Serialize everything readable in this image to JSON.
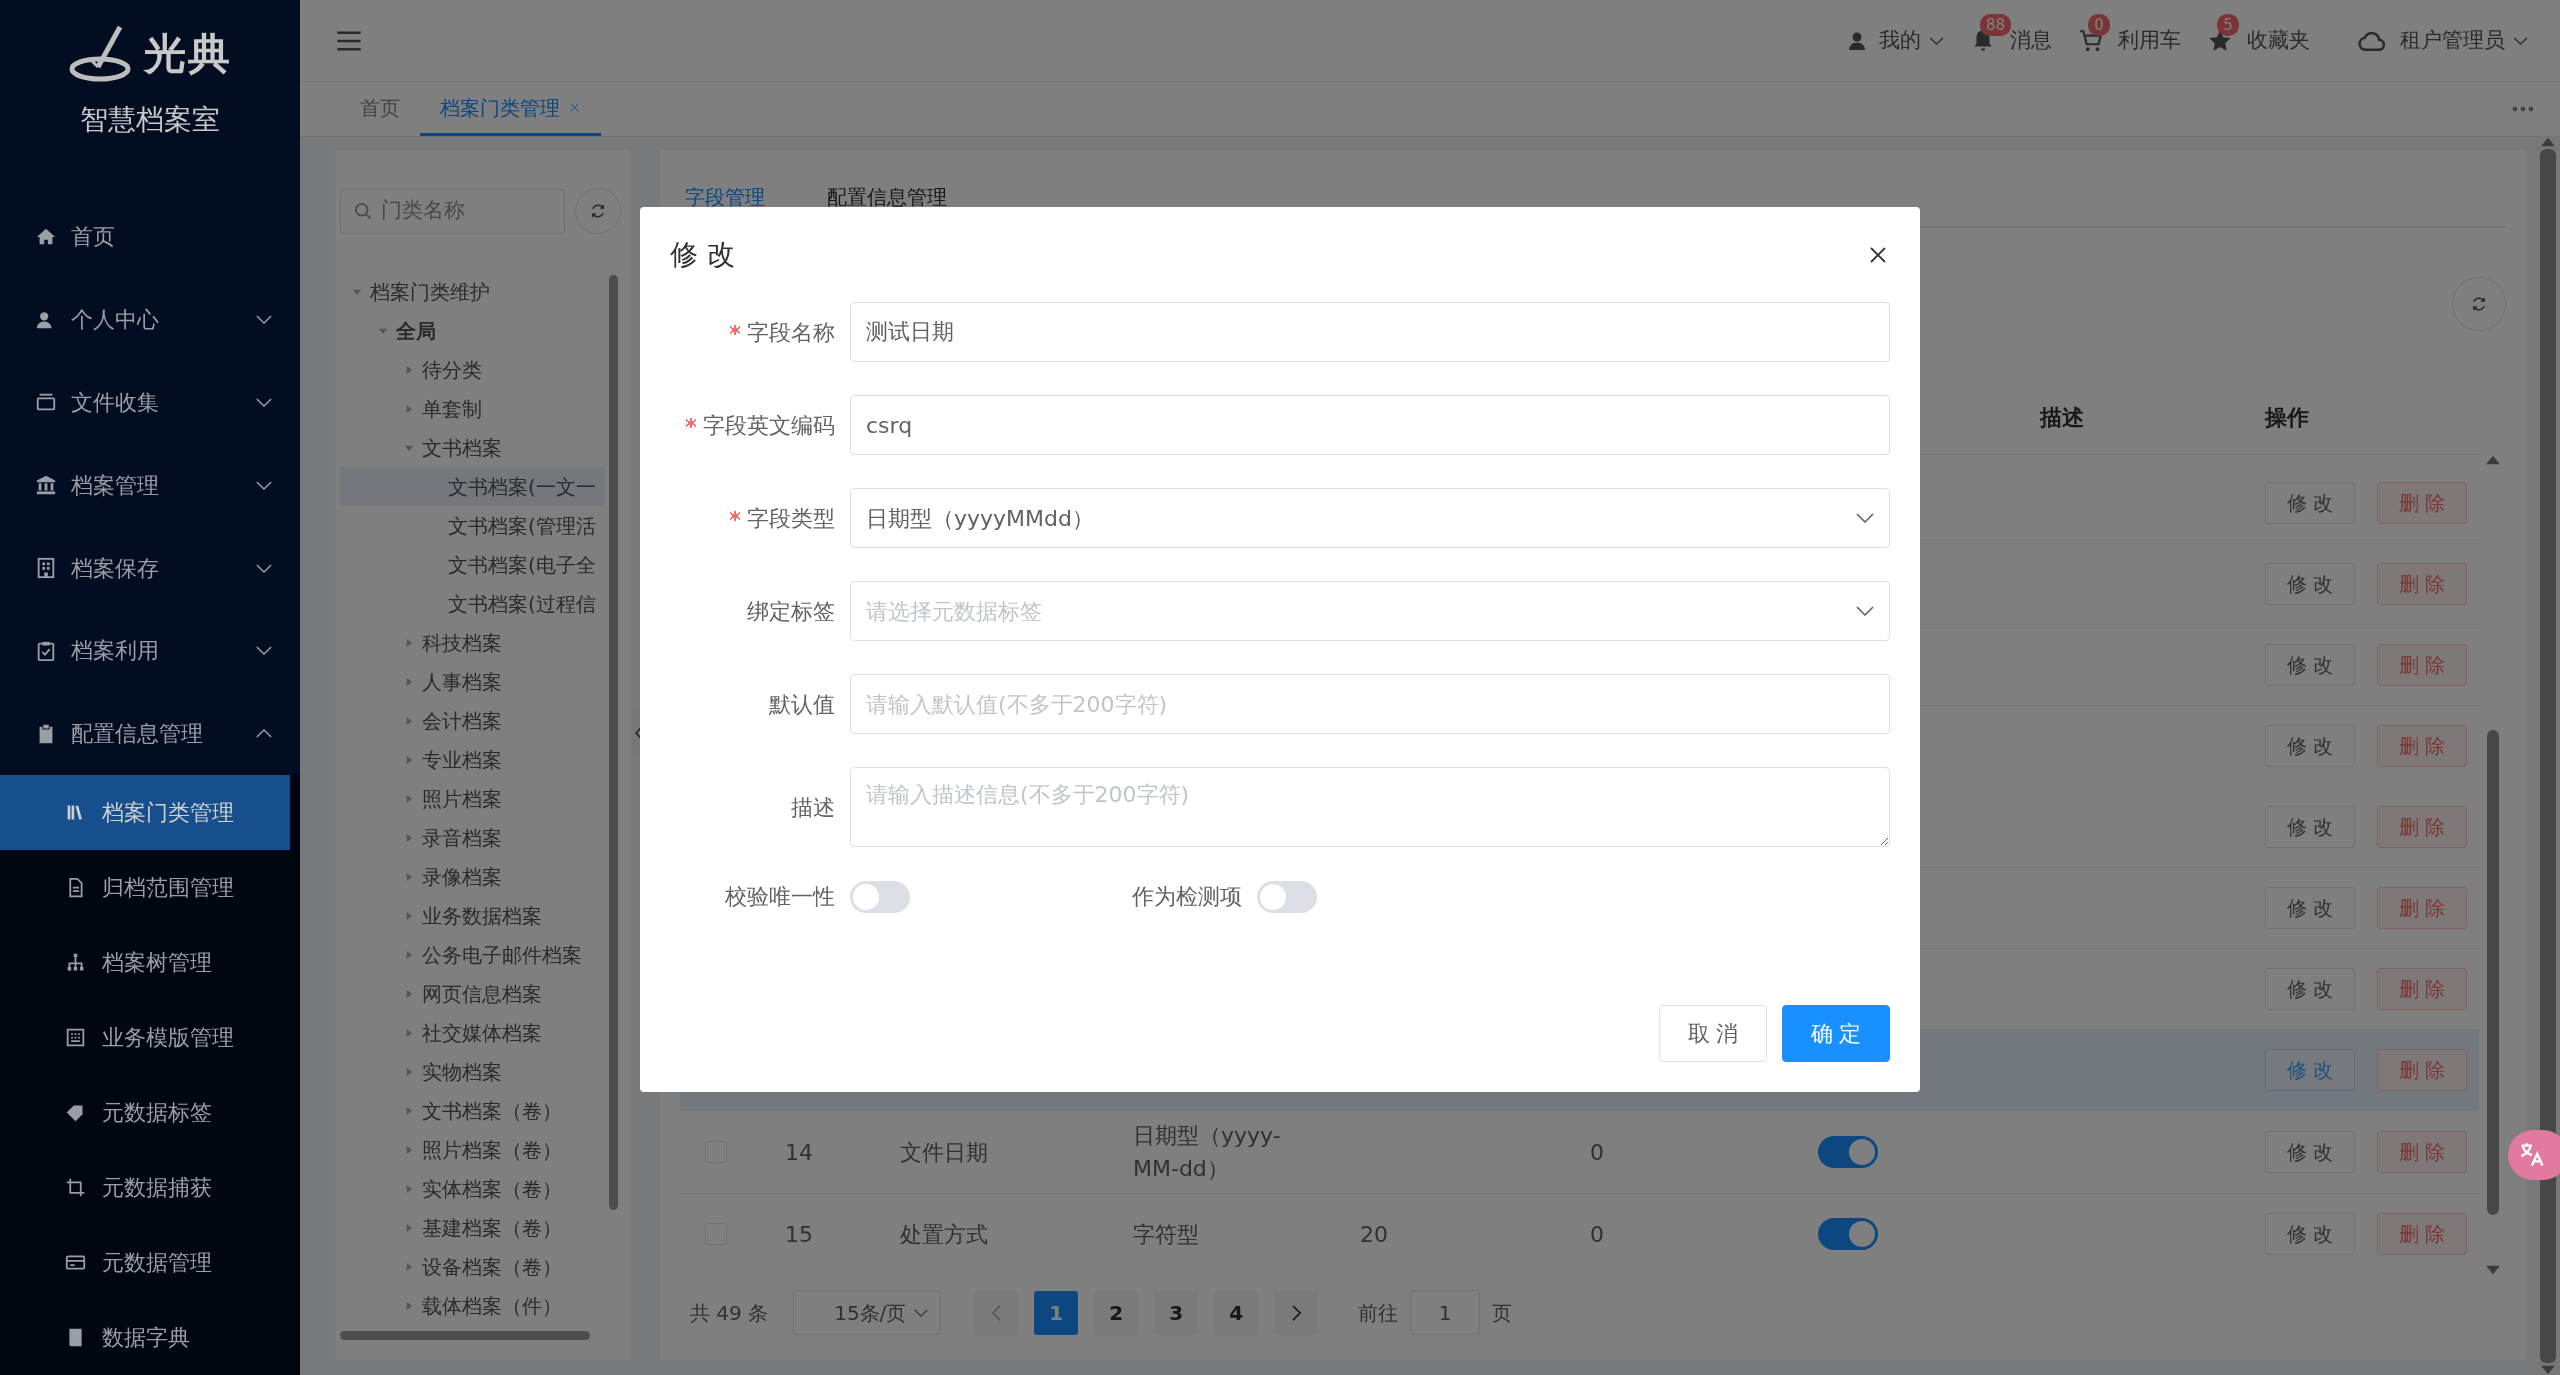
{
  "sidebar": {
    "logo_text": "光典",
    "subtitle": "智慧档案室",
    "items": [
      {
        "label": "首页",
        "kind": "home",
        "selected": false
      },
      {
        "label": "个人中心",
        "kind": "user",
        "selected": false,
        "expanded": false
      },
      {
        "label": "文件收集",
        "kind": "tray",
        "selected": false,
        "expanded": false
      },
      {
        "label": "档案管理",
        "kind": "bank",
        "selected": false,
        "expanded": false
      },
      {
        "label": "档案保存",
        "kind": "building",
        "selected": false,
        "expanded": false
      },
      {
        "label": "档案利用",
        "kind": "clipboard-check",
        "selected": false,
        "expanded": false
      },
      {
        "label": "配置信息管理",
        "kind": "clipboard",
        "selected": false,
        "expanded": true,
        "children": [
          {
            "label": "档案门类管理",
            "kind": "books",
            "selected": true
          },
          {
            "label": "归档范围管理",
            "kind": "document",
            "selected": false
          },
          {
            "label": "档案树管理",
            "kind": "sitemap",
            "selected": false
          },
          {
            "label": "业务模版管理",
            "kind": "grid",
            "selected": false
          },
          {
            "label": "元数据标签",
            "kind": "tag",
            "selected": false
          },
          {
            "label": "元数据捕获",
            "kind": "crop",
            "selected": false
          },
          {
            "label": "元数据管理",
            "kind": "card",
            "selected": false
          },
          {
            "label": "数据字典",
            "kind": "book",
            "selected": false
          }
        ]
      }
    ]
  },
  "header": {
    "user_menu": "我的",
    "shortcuts": [
      {
        "kind": "bell",
        "label": "消息",
        "count": "88"
      },
      {
        "kind": "cart",
        "label": "利用车",
        "count": "0"
      },
      {
        "kind": "star",
        "label": "收藏夹",
        "count": "5"
      }
    ],
    "account": "租户管理员"
  },
  "page_tabs": [
    {
      "label": "首页",
      "selected": false,
      "closable": false
    },
    {
      "label": "档案门类管理",
      "selected": true,
      "closable": true
    }
  ],
  "tree": {
    "search_placeholder": "门类名称",
    "nodes": [
      {
        "label": "档案门类维护",
        "expanded": true,
        "selected": false,
        "children": [
          {
            "label": "全局",
            "expanded": true,
            "selected": false,
            "children": [
              {
                "label": "待分类",
                "expanded": false,
                "selected": false
              },
              {
                "label": "单套制",
                "expanded": false,
                "selected": false
              },
              {
                "label": "文书档案",
                "expanded": true,
                "selected": false,
                "children": [
                  {
                    "label": "文书档案(一文一",
                    "selected": true
                  },
                  {
                    "label": "文书档案(管理活",
                    "selected": false
                  },
                  {
                    "label": "文书档案(电子全",
                    "selected": false
                  },
                  {
                    "label": "文书档案(过程信",
                    "selected": false
                  }
                ]
              },
              {
                "label": "科技档案",
                "expanded": false,
                "selected": false
              },
              {
                "label": "人事档案",
                "expanded": false,
                "selected": false
              },
              {
                "label": "会计档案",
                "expanded": false,
                "selected": false
              },
              {
                "label": "专业档案",
                "expanded": false,
                "selected": false
              },
              {
                "label": "照片档案",
                "expanded": false,
                "selected": false
              },
              {
                "label": "录音档案",
                "expanded": false,
                "selected": false
              },
              {
                "label": "录像档案",
                "expanded": false,
                "selected": false
              },
              {
                "label": "业务数据档案",
                "expanded": false,
                "selected": false
              },
              {
                "label": "公务电子邮件档案",
                "expanded": false,
                "selected": false
              },
              {
                "label": "网页信息档案",
                "expanded": false,
                "selected": false
              },
              {
                "label": "社交媒体档案",
                "expanded": false,
                "selected": false
              },
              {
                "label": "实物档案",
                "expanded": false,
                "selected": false
              },
              {
                "label": "文书档案（卷）",
                "expanded": false,
                "selected": false
              },
              {
                "label": "照片档案（卷）",
                "expanded": false,
                "selected": false
              },
              {
                "label": "实体档案（卷）",
                "expanded": false,
                "selected": false
              },
              {
                "label": "基建档案（卷）",
                "expanded": false,
                "selected": false
              },
              {
                "label": "设备档案（卷）",
                "expanded": false,
                "selected": false
              },
              {
                "label": "载体档案（件）",
                "expanded": false,
                "selected": false
              }
            ]
          }
        ]
      }
    ]
  },
  "panel_tabs": [
    {
      "label": "字段管理",
      "selected": true
    },
    {
      "label": "配置信息管理",
      "selected": false
    }
  ],
  "table": {
    "columns": [
      {
        "label": "描述"
      },
      {
        "label": "操作"
      }
    ],
    "rows": [
      {
        "selected": false,
        "actions": [
          {
            "label": "修 改",
            "kind": "edit"
          },
          {
            "label": "删 除",
            "kind": "delete"
          }
        ]
      },
      {
        "selected": false,
        "actions": [
          {
            "label": "修 改",
            "kind": "edit"
          },
          {
            "label": "删 除",
            "kind": "delete"
          }
        ]
      },
      {
        "selected": false,
        "actions": [
          {
            "label": "修 改",
            "kind": "edit"
          },
          {
            "label": "删 除",
            "kind": "delete"
          }
        ]
      },
      {
        "selected": false,
        "actions": [
          {
            "label": "修 改",
            "kind": "edit"
          },
          {
            "label": "删 除",
            "kind": "delete"
          }
        ]
      },
      {
        "selected": false,
        "actions": [
          {
            "label": "修 改",
            "kind": "edit"
          },
          {
            "label": "删 除",
            "kind": "delete"
          }
        ]
      },
      {
        "selected": false,
        "actions": [
          {
            "label": "修 改",
            "kind": "edit"
          },
          {
            "label": "删 除",
            "kind": "delete"
          }
        ]
      },
      {
        "selected": false,
        "actions": [
          {
            "label": "修 改",
            "kind": "edit"
          },
          {
            "label": "删 除",
            "kind": "delete"
          }
        ]
      },
      {
        "selected": true,
        "actions": [
          {
            "label": "修 改",
            "kind": "edit"
          },
          {
            "label": "删 除",
            "kind": "delete"
          }
        ]
      },
      {
        "selected": false,
        "checked": false,
        "no": "14",
        "name": "文件日期",
        "type": "日期型（yyyy-MM-dd）",
        "column_6": "0",
        "enabled": true,
        "actions": [
          {
            "label": "修 改",
            "kind": "edit"
          },
          {
            "label": "删 除",
            "kind": "delete"
          }
        ]
      },
      {
        "selected": false,
        "checked": false,
        "no": "15",
        "name": "处置方式",
        "type": "字符型",
        "length": "20",
        "column_6": "0",
        "enabled": true,
        "actions": [
          {
            "label": "修 改",
            "kind": "edit"
          },
          {
            "label": "删 除",
            "kind": "delete"
          }
        ]
      }
    ]
  },
  "pagination": {
    "total": "共 49 条",
    "page_size": "15条/页",
    "pages": [
      {
        "label": "1",
        "selected": true
      },
      {
        "label": "2",
        "selected": false
      },
      {
        "label": "3",
        "selected": false
      },
      {
        "label": "4",
        "selected": false
      }
    ],
    "goto_label": "前往",
    "goto_value": "1",
    "goto_suffix": "页"
  },
  "dialog": {
    "title": "修 改",
    "fields": [
      {
        "label": "字段名称",
        "required": true,
        "kind": "input",
        "value": "测试日期"
      },
      {
        "label": "字段英文编码",
        "required": true,
        "kind": "input",
        "value": "csrq"
      },
      {
        "label": "字段类型",
        "required": true,
        "kind": "select",
        "value": "日期型（yyyyMMdd）"
      },
      {
        "label": "绑定标签",
        "required": false,
        "kind": "select",
        "placeholder": "请选择元数据标签"
      },
      {
        "label": "默认值",
        "required": false,
        "kind": "input",
        "placeholder": "请输入默认值(不多于200字符)"
      },
      {
        "label": "描述",
        "required": false,
        "kind": "textarea",
        "placeholder": "请输入描述信息(不多于200字符)"
      }
    ],
    "switches": [
      {
        "label": "校验唯一性",
        "on": false
      },
      {
        "label": "作为检测项",
        "on": false
      }
    ],
    "buttons": [
      {
        "label": "取 消",
        "kind": "secondary"
      },
      {
        "label": "确 定",
        "kind": "primary"
      }
    ]
  }
}
